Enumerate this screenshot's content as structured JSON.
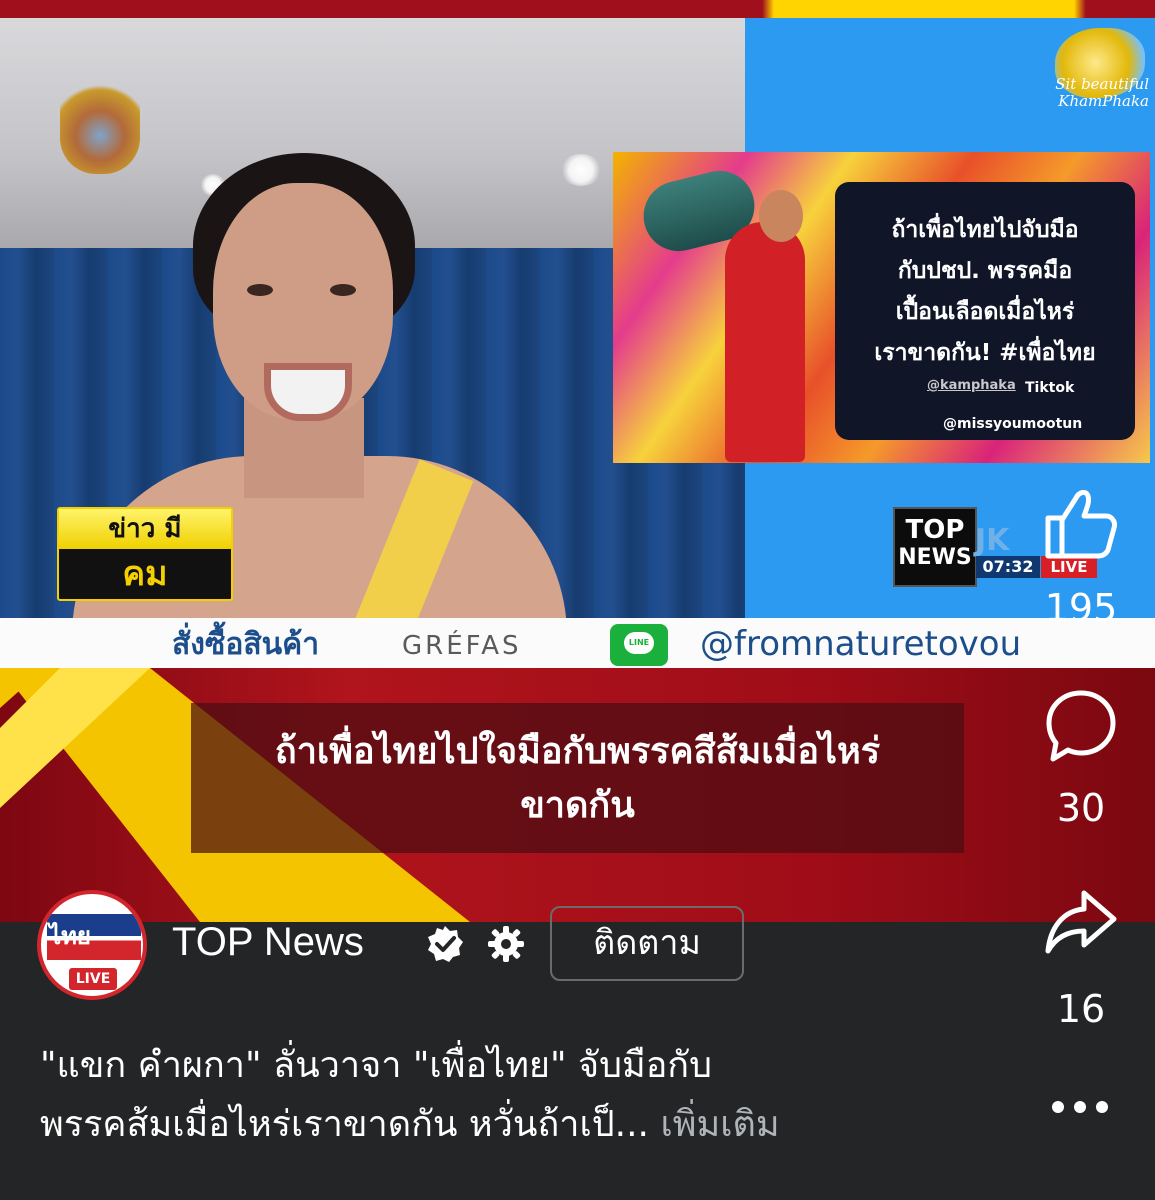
{
  "video": {
    "inset_headline": "ถ้าเพื่อไทยไปจับมือกับปชป. พรรคมือเปื้อนเลือดเมื่อไหร่เราขาดกัน! #เพื่อไทย",
    "inset_line1": "ถ้าเพื่อไทยไปจับมือ",
    "inset_line2": "กับปชป. พรรคมือ",
    "inset_line3": "เปื้อนเลือดเมื่อไหร่",
    "inset_line4": "เราขาดกัน! #เพื่อไทย",
    "inset_handle": "@kamphaka",
    "inset_platform": "Tiktok",
    "inset_handle2": "@missyoumootun",
    "side_caption": "Sit beautiful\nKhamPhaka",
    "program_badge_top": "ข่าว มี",
    "program_badge_bottom": "คม",
    "logo_line1": "TOP",
    "logo_line2": "NEWS",
    "logo_jk": "JK",
    "time": "07:32",
    "live_label": "LIVE",
    "ticker_left": "สั่งซื้อสินค้า",
    "ticker_brand": "GRÉFAS",
    "ticker_line_label": "LINE",
    "ticker_handle": "@fromnaturetovou",
    "caption_line1": "ถ้าเพื่อไทยไปใจมือกับพรรคสีส้มเมื่อไหร่",
    "caption_line2": "ขาดกัน"
  },
  "post": {
    "channel_name": "TOP News",
    "follow_label": "ติดตาม",
    "avatar_text": "ไทย",
    "avatar_live": "LIVE",
    "description_line1": "\"แขก คำผกา\" ลั่นวาจา \"เพื่อไทย\" จับมือกับ",
    "description_line2": "พรรคส้มเมื่อไหร่เราขาดกัน หวั่นถ้าเป็...",
    "more_label": "เพิ่มเติม"
  },
  "actions": {
    "likes": "195",
    "comments": "30",
    "shares": "16"
  },
  "icons": [
    "like-icon",
    "comment-icon",
    "share-icon",
    "more-icon",
    "verified-icon",
    "gear-icon",
    "line-icon"
  ],
  "colors": {
    "accent_red": "#a0101c",
    "accent_yellow": "#ffd400",
    "panel_dark": "#242526"
  }
}
